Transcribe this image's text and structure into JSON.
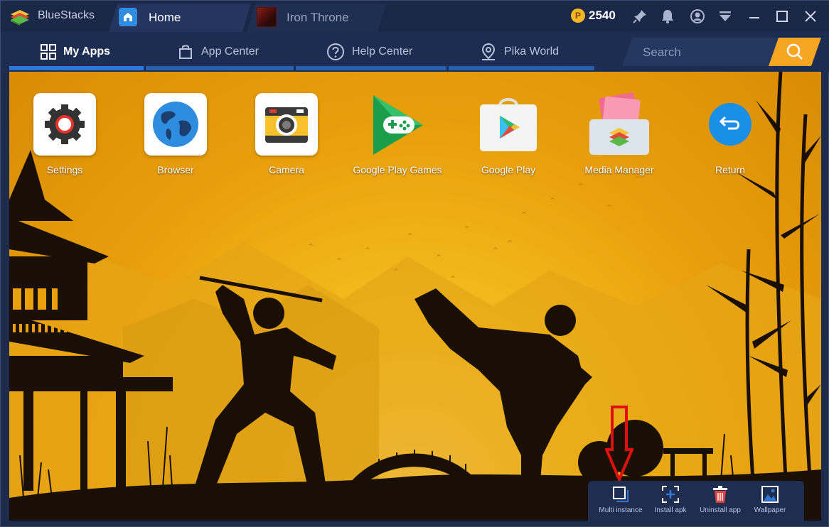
{
  "titlebar": {
    "app_name": "BlueStacks",
    "tabs": [
      {
        "label": "Home",
        "icon": "home-icon"
      },
      {
        "label": "Iron Throne",
        "icon": "game-thumbnail"
      }
    ],
    "coins": "2540",
    "icons": [
      "pin-icon",
      "bell-icon",
      "account-icon",
      "dropdown-icon",
      "minimize-icon",
      "maximize-icon",
      "close-icon"
    ]
  },
  "nav": {
    "items": [
      {
        "label": "My Apps",
        "icon": "grid-icon",
        "active": true
      },
      {
        "label": "App Center",
        "icon": "bag-icon",
        "active": false
      },
      {
        "label": "Help Center",
        "icon": "help-icon",
        "active": false
      },
      {
        "label": "Pika World",
        "icon": "location-icon",
        "active": false
      }
    ],
    "search_placeholder": "Search"
  },
  "apps": [
    {
      "label": "Settings",
      "icon": "settings-gear-icon"
    },
    {
      "label": "Browser",
      "icon": "globe-icon"
    },
    {
      "label": "Camera",
      "icon": "camera-icon"
    },
    {
      "label": "Google Play Games",
      "icon": "gamepad-icon"
    },
    {
      "label": "Google Play",
      "icon": "play-store-icon"
    },
    {
      "label": "Media Manager",
      "icon": "folder-icon"
    },
    {
      "label": "Return",
      "icon": "return-icon"
    }
  ],
  "tray": [
    {
      "label": "Multi instance",
      "icon": "multi-instance-icon"
    },
    {
      "label": "Install apk",
      "icon": "install-apk-icon"
    },
    {
      "label": "Uninstall app",
      "icon": "trash-icon"
    },
    {
      "label": "Wallpaper",
      "icon": "image-icon"
    }
  ],
  "colors": {
    "accent": "#2e76d8",
    "search_button": "#f6a623",
    "annotation_arrow": "#e01010",
    "wallpaper": "#f0b018"
  }
}
